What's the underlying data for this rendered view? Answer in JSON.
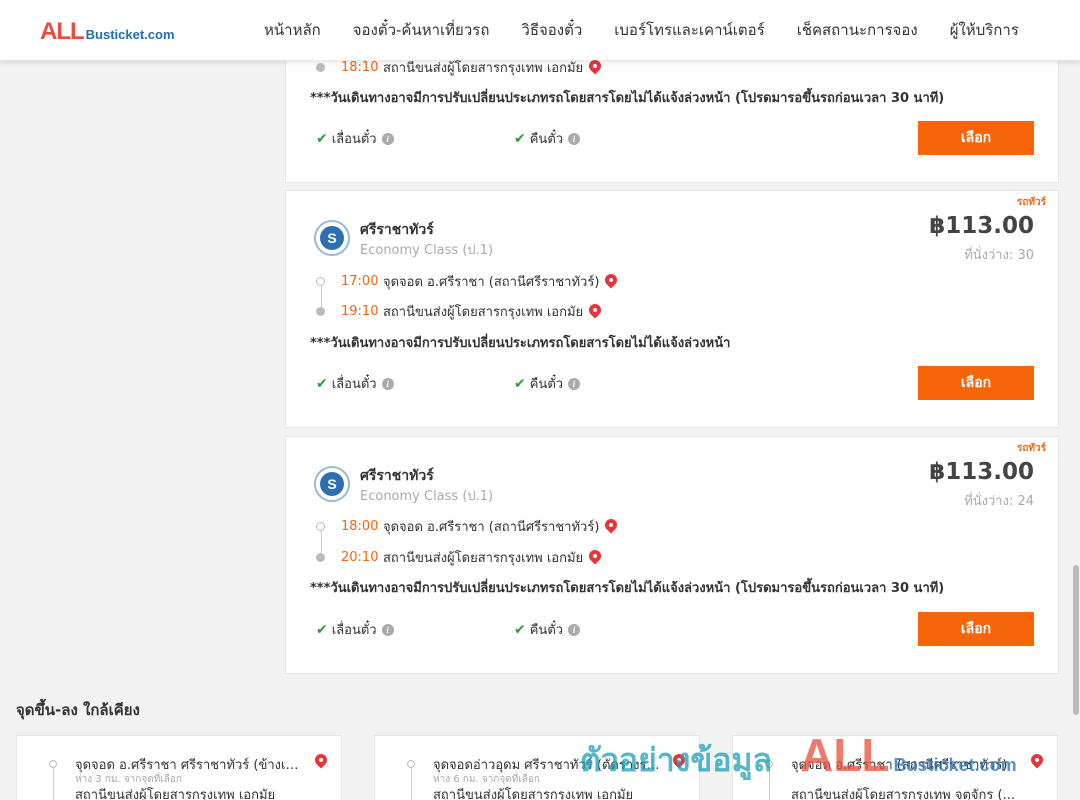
{
  "header": {
    "logo_all": "ALL",
    "logo_site": "Busticket.com",
    "nav": [
      "หน้าหลัก",
      "จองตั๋ว-ค้นหาเที่ยวรถ",
      "วิธีจองตั๋ว",
      "เบอร์โทรและเคาน์เตอร์",
      "เช็คสถานะการจอง",
      "ผู้ให้บริการ"
    ]
  },
  "trips": [
    {
      "arrive_time": "18:10",
      "arrive_place": "สถานีขนส่งผู้โดยสารกรุงเทพ เอกมัย",
      "note": "***วันเดินทางอาจมีการปรับเปลี่ยนประเภทรถโดยสารโดยไม่ได้แจ้งล่วงหน้า (โปรดมารอขึ้นรถก่อนเวลา 30 นาที)",
      "change_label": "เลื่อนตั๋ว",
      "refund_label": "คืนตั๋ว",
      "select_label": "เลือก"
    },
    {
      "tag": "รถทัวร์",
      "operator": "ศรีราชาทัวร์",
      "bus_class": "Economy Class (ป.1)",
      "price": "฿113.00",
      "seats": "ที่นั่งว่าง: 30",
      "depart_time": "17:00",
      "depart_place": "จุดจอด อ.ศรีราชา (สถานีศรีราชาทัวร์)",
      "arrive_time": "19:10",
      "arrive_place": "สถานีขนส่งผู้โดยสารกรุงเทพ เอกมัย",
      "note": "***วันเดินทางอาจมีการปรับเปลี่ยนประเภทรถโดยสารโดยไม่ได้แจ้งล่วงหน้า",
      "change_label": "เลื่อนตั๋ว",
      "refund_label": "คืนตั๋ว",
      "select_label": "เลือก"
    },
    {
      "tag": "รถทัวร์",
      "operator": "ศรีราชาทัวร์",
      "bus_class": "Economy Class (ป.1)",
      "price": "฿113.00",
      "seats": "ที่นั่งว่าง: 24",
      "depart_time": "18:00",
      "depart_place": "จุดจอด อ.ศรีราชา (สถานีศรีราชาทัวร์)",
      "arrive_time": "20:10",
      "arrive_place": "สถานีขนส่งผู้โดยสารกรุงเทพ เอกมัย",
      "note": "***วันเดินทางอาจมีการปรับเปลี่ยนประเภทรถโดยสารโดยไม่ได้แจ้งล่วงหน้า (โปรดมารอขึ้นรถก่อนเวลา 30 นาที)",
      "change_label": "เลื่อนตั๋ว",
      "refund_label": "คืนตั๋ว",
      "select_label": "เลือก"
    }
  ],
  "nearby": {
    "title": "จุดขึ้น-ลง ใกล้เคียง",
    "items": [
      {
        "name": "จุดจอด อ.ศรีราชา ศรีราชาทัวร์ (ข้างเซ็...",
        "distance": "ห่าง 3 กม. จากจุดที่เลือก",
        "name2": "สถานีขนส่งผู้โดยสารกรุงเทพ เอกมัย"
      },
      {
        "name": "จุดจอดอ่าวอุดม ศรีราชาทัวร์ (ตัดรางรถไฟ...",
        "distance": "ห่าง 6 กม. จากจุดที่เลือก",
        "name2": "สถานีขนส่งผู้โดยสารกรุงเทพ เอกมัย"
      },
      {
        "name": "จุดจอด อ.ศรีราชา (สถานีศรีราชาทัวร์)",
        "distance": "",
        "name2": "สถานีขนส่งผู้โดยสารกรุงเทพ จตุจักร (..."
      }
    ]
  },
  "watermark": {
    "text": "ตัวอย่างข้อมูล",
    "all": "ALL",
    "site": "Busticket.com"
  },
  "colors": {
    "accent": "#f7650a",
    "brand_red": "#e94e3c",
    "brand_blue": "#1f6fb5",
    "check_green": "#2e9b3a"
  }
}
